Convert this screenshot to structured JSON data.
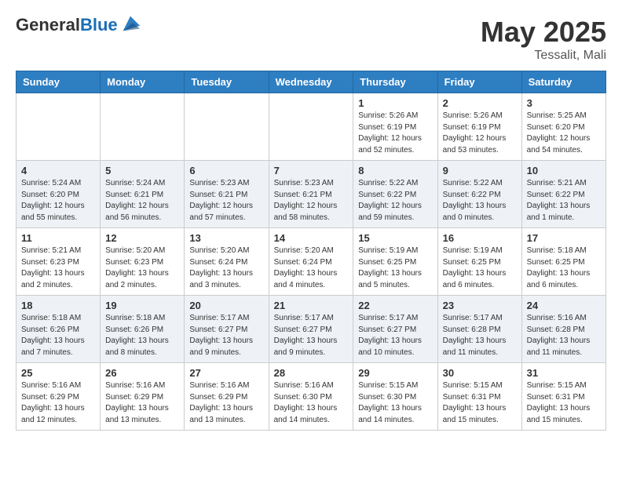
{
  "header": {
    "logo_line1": "General",
    "logo_line2": "Blue",
    "month": "May 2025",
    "location": "Tessalit, Mali"
  },
  "days_of_week": [
    "Sunday",
    "Monday",
    "Tuesday",
    "Wednesday",
    "Thursday",
    "Friday",
    "Saturday"
  ],
  "weeks": [
    [
      {
        "day": "",
        "info": ""
      },
      {
        "day": "",
        "info": ""
      },
      {
        "day": "",
        "info": ""
      },
      {
        "day": "",
        "info": ""
      },
      {
        "day": "1",
        "info": "Sunrise: 5:26 AM\nSunset: 6:19 PM\nDaylight: 12 hours\nand 52 minutes."
      },
      {
        "day": "2",
        "info": "Sunrise: 5:26 AM\nSunset: 6:19 PM\nDaylight: 12 hours\nand 53 minutes."
      },
      {
        "day": "3",
        "info": "Sunrise: 5:25 AM\nSunset: 6:20 PM\nDaylight: 12 hours\nand 54 minutes."
      }
    ],
    [
      {
        "day": "4",
        "info": "Sunrise: 5:24 AM\nSunset: 6:20 PM\nDaylight: 12 hours\nand 55 minutes."
      },
      {
        "day": "5",
        "info": "Sunrise: 5:24 AM\nSunset: 6:21 PM\nDaylight: 12 hours\nand 56 minutes."
      },
      {
        "day": "6",
        "info": "Sunrise: 5:23 AM\nSunset: 6:21 PM\nDaylight: 12 hours\nand 57 minutes."
      },
      {
        "day": "7",
        "info": "Sunrise: 5:23 AM\nSunset: 6:21 PM\nDaylight: 12 hours\nand 58 minutes."
      },
      {
        "day": "8",
        "info": "Sunrise: 5:22 AM\nSunset: 6:22 PM\nDaylight: 12 hours\nand 59 minutes."
      },
      {
        "day": "9",
        "info": "Sunrise: 5:22 AM\nSunset: 6:22 PM\nDaylight: 13 hours\nand 0 minutes."
      },
      {
        "day": "10",
        "info": "Sunrise: 5:21 AM\nSunset: 6:22 PM\nDaylight: 13 hours\nand 1 minute."
      }
    ],
    [
      {
        "day": "11",
        "info": "Sunrise: 5:21 AM\nSunset: 6:23 PM\nDaylight: 13 hours\nand 2 minutes."
      },
      {
        "day": "12",
        "info": "Sunrise: 5:20 AM\nSunset: 6:23 PM\nDaylight: 13 hours\nand 2 minutes."
      },
      {
        "day": "13",
        "info": "Sunrise: 5:20 AM\nSunset: 6:24 PM\nDaylight: 13 hours\nand 3 minutes."
      },
      {
        "day": "14",
        "info": "Sunrise: 5:20 AM\nSunset: 6:24 PM\nDaylight: 13 hours\nand 4 minutes."
      },
      {
        "day": "15",
        "info": "Sunrise: 5:19 AM\nSunset: 6:25 PM\nDaylight: 13 hours\nand 5 minutes."
      },
      {
        "day": "16",
        "info": "Sunrise: 5:19 AM\nSunset: 6:25 PM\nDaylight: 13 hours\nand 6 minutes."
      },
      {
        "day": "17",
        "info": "Sunrise: 5:18 AM\nSunset: 6:25 PM\nDaylight: 13 hours\nand 6 minutes."
      }
    ],
    [
      {
        "day": "18",
        "info": "Sunrise: 5:18 AM\nSunset: 6:26 PM\nDaylight: 13 hours\nand 7 minutes."
      },
      {
        "day": "19",
        "info": "Sunrise: 5:18 AM\nSunset: 6:26 PM\nDaylight: 13 hours\nand 8 minutes."
      },
      {
        "day": "20",
        "info": "Sunrise: 5:17 AM\nSunset: 6:27 PM\nDaylight: 13 hours\nand 9 minutes."
      },
      {
        "day": "21",
        "info": "Sunrise: 5:17 AM\nSunset: 6:27 PM\nDaylight: 13 hours\nand 9 minutes."
      },
      {
        "day": "22",
        "info": "Sunrise: 5:17 AM\nSunset: 6:27 PM\nDaylight: 13 hours\nand 10 minutes."
      },
      {
        "day": "23",
        "info": "Sunrise: 5:17 AM\nSunset: 6:28 PM\nDaylight: 13 hours\nand 11 minutes."
      },
      {
        "day": "24",
        "info": "Sunrise: 5:16 AM\nSunset: 6:28 PM\nDaylight: 13 hours\nand 11 minutes."
      }
    ],
    [
      {
        "day": "25",
        "info": "Sunrise: 5:16 AM\nSunset: 6:29 PM\nDaylight: 13 hours\nand 12 minutes."
      },
      {
        "day": "26",
        "info": "Sunrise: 5:16 AM\nSunset: 6:29 PM\nDaylight: 13 hours\nand 13 minutes."
      },
      {
        "day": "27",
        "info": "Sunrise: 5:16 AM\nSunset: 6:29 PM\nDaylight: 13 hours\nand 13 minutes."
      },
      {
        "day": "28",
        "info": "Sunrise: 5:16 AM\nSunset: 6:30 PM\nDaylight: 13 hours\nand 14 minutes."
      },
      {
        "day": "29",
        "info": "Sunrise: 5:15 AM\nSunset: 6:30 PM\nDaylight: 13 hours\nand 14 minutes."
      },
      {
        "day": "30",
        "info": "Sunrise: 5:15 AM\nSunset: 6:31 PM\nDaylight: 13 hours\nand 15 minutes."
      },
      {
        "day": "31",
        "info": "Sunrise: 5:15 AM\nSunset: 6:31 PM\nDaylight: 13 hours\nand 15 minutes."
      }
    ]
  ]
}
